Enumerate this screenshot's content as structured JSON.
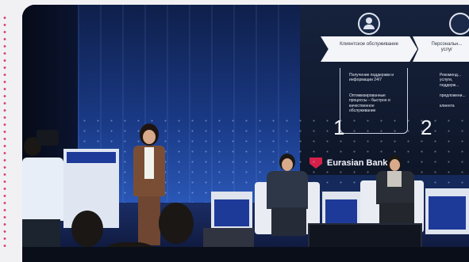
{
  "screen": {
    "card1": {
      "title": "Клиентское обслуживание",
      "number": "1",
      "bullets": [
        "Получение поддержки и информации 24/7",
        "Оптимизированные процессы – быстрое и качественное обслуживание"
      ]
    },
    "card2": {
      "title": "Персональн... услуг",
      "number": "2",
      "bullets": [
        "Рекоменд... услуги,",
        "поддерж...",
        "предложени...",
        "клиента"
      ]
    }
  },
  "brand": {
    "name": "Eurasian Bank",
    "accent": "#d6204a"
  },
  "colors": {
    "backdrop": "#12254f",
    "stage_light": "#2a57b6",
    "desk_panel": "#1e3a99",
    "page_dots": "#d6457a"
  }
}
